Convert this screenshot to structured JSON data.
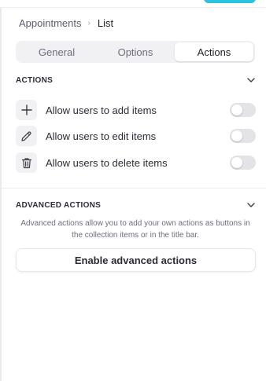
{
  "breadcrumb": {
    "root": "Appointments",
    "separator": "›",
    "current": "List"
  },
  "tabs": [
    {
      "label": "General",
      "active": false
    },
    {
      "label": "Options",
      "active": false
    },
    {
      "label": "Actions",
      "active": true
    }
  ],
  "actions_section": {
    "title": "ACTIONS",
    "chevron_icon": "chevron-down-icon",
    "items": [
      {
        "label": "Allow users to add items",
        "icon": "plus-icon",
        "enabled": false
      },
      {
        "label": "Allow users to edit items",
        "icon": "pencil-icon",
        "enabled": false
      },
      {
        "label": "Allow users to delete items",
        "icon": "trash-icon",
        "enabled": false
      }
    ]
  },
  "advanced_section": {
    "title": "ADVANCED ACTIONS",
    "chevron_icon": "chevron-down-icon",
    "description": "Advanced actions allow you to add your own actions as buttons in the collection items or in the title bar.",
    "button_label": "Enable advanced actions"
  },
  "colors": {
    "accent": "#29c3e1",
    "toggle_off": "#e3e3e8",
    "tab_track": "#f1f1f4"
  }
}
